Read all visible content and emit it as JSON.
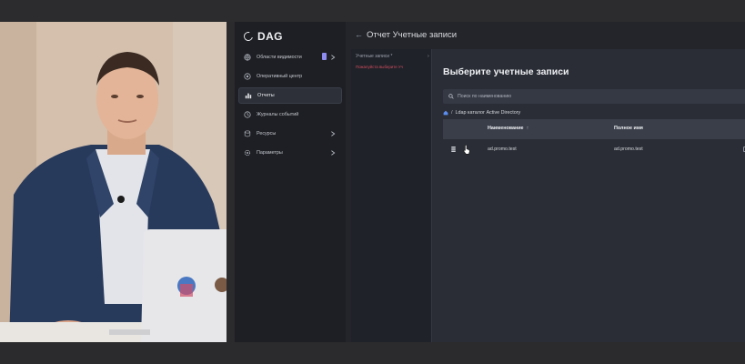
{
  "app": {
    "logo": "DAG"
  },
  "sidebar": {
    "items": [
      {
        "label": "Области видимости",
        "icon": "globe-icon",
        "active": false,
        "badge": true,
        "chevron": true
      },
      {
        "label": "Оперативный центр",
        "icon": "radar-icon",
        "active": false,
        "badge": false,
        "chevron": false
      },
      {
        "label": "Отчеты",
        "icon": "chart-icon",
        "active": true,
        "badge": false,
        "chevron": false
      },
      {
        "label": "Журналы событий",
        "icon": "journal-icon",
        "active": false,
        "badge": false,
        "chevron": false
      },
      {
        "label": "Ресурсы",
        "icon": "database-icon",
        "active": false,
        "badge": false,
        "chevron": true
      },
      {
        "label": "Параметры",
        "icon": "gear-icon",
        "active": false,
        "badge": false,
        "chevron": true
      }
    ]
  },
  "header": {
    "title": "Отчет Учетные записи"
  },
  "form": {
    "field_label": "Учетные записи *",
    "error": "Пожалуйста выберите Уч"
  },
  "modal": {
    "title": "Выберите учетные записи",
    "search_placeholder": "Поиск по наименованию",
    "breadcrumb_sep": "/",
    "breadcrumb": "Ldap каталог Active Directory",
    "columns": {
      "name": "Наименование",
      "sort": "↑",
      "full_name": "Полное имя"
    },
    "rows": [
      {
        "name": "ad.promo.test",
        "full_name": "ad.promo.test"
      }
    ]
  },
  "colors": {
    "accent_badge": "#8f8cf0",
    "error": "#d24e5d",
    "sidebar_bg": "#1d1f24",
    "modal_bg": "#2a2d35"
  }
}
